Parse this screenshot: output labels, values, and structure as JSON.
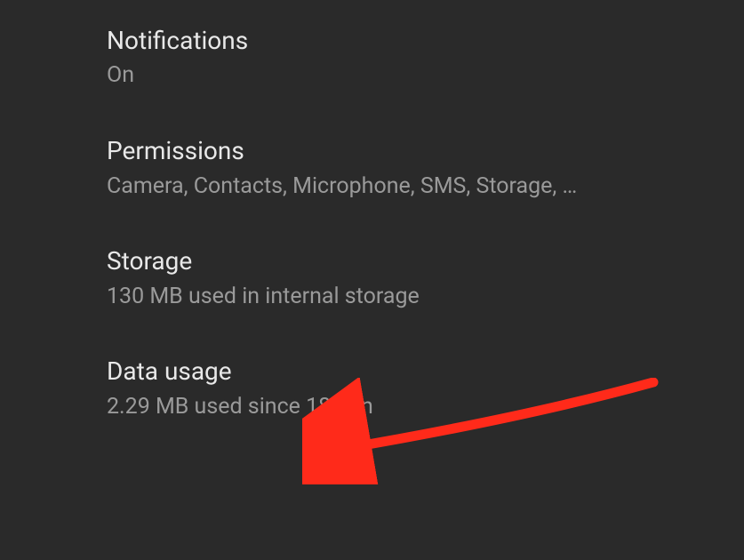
{
  "settings": {
    "items": [
      {
        "title": "Notifications",
        "subtitle": "On"
      },
      {
        "title": "Permissions",
        "subtitle": "Camera, Contacts, Microphone, SMS, Storage, …"
      },
      {
        "title": "Storage",
        "subtitle": "130 MB used in internal storage"
      },
      {
        "title": "Data usage",
        "subtitle": "2.29 MB used since 18 Jun"
      }
    ]
  }
}
